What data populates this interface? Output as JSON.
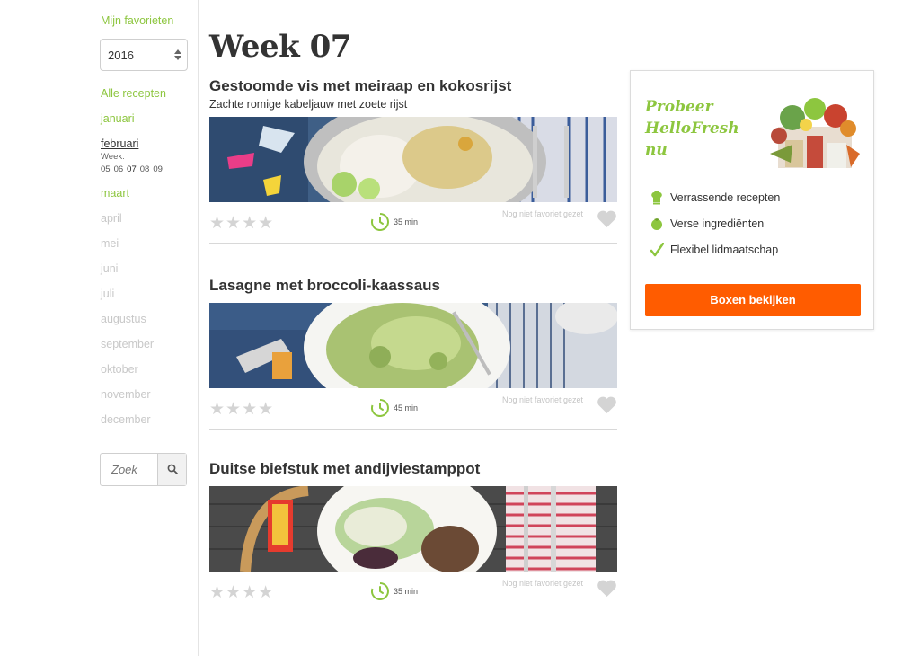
{
  "sidebar": {
    "favorites_label": "Mijn favorieten",
    "year": "2016",
    "all_recipes": "Alle recepten",
    "months": {
      "januari": "januari",
      "februari": "februari",
      "maart": "maart",
      "april": "april",
      "mei": "mei",
      "juni": "juni",
      "juli": "juli",
      "augustus": "augustus",
      "september": "september",
      "oktober": "oktober",
      "november": "november",
      "december": "december"
    },
    "week_label": "Week:",
    "weeks": [
      "05",
      "06",
      "07",
      "08",
      "09"
    ],
    "current_week": "07",
    "search_placeholder": "Zoek"
  },
  "main": {
    "title": "Week 07",
    "recipes": [
      {
        "title": "Gestoomde vis met meiraap en kokosrijst",
        "subtitle": "Zachte romige kabeljauw met zoete rijst",
        "time": "35 min",
        "favorite_text": "Nog niet favoriet gezet",
        "stars": "★★★★"
      },
      {
        "title": "Lasagne met broccoli-kaassaus",
        "subtitle": "",
        "time": "45 min",
        "favorite_text": "Nog niet favoriet gezet",
        "stars": "★★★★"
      },
      {
        "title": "Duitse biefstuk met andijviestamppot",
        "subtitle": "",
        "time": "35 min",
        "favorite_text": "Nog niet favoriet gezet",
        "stars": "★★★★"
      }
    ]
  },
  "promo": {
    "title_line1": "Probeer",
    "title_line2": "HelloFresh",
    "title_line3": "nu",
    "features": [
      "Verrassende recepten",
      "Verse ingrediënten",
      "Flexibel lidmaatschap"
    ],
    "cta": "Boxen bekijken"
  },
  "colors": {
    "accent_green": "#8dc63f",
    "cta_orange": "#ff5c00",
    "muted_grey": "#c8c8c8"
  }
}
